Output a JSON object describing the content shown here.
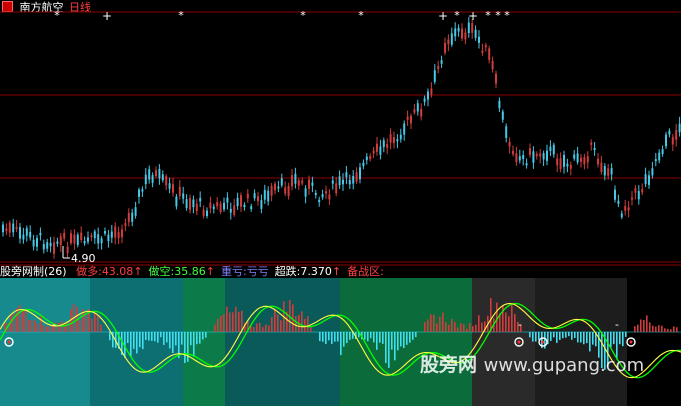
{
  "header": {
    "stock_name": "南方航空",
    "period": "日线"
  },
  "main_chart": {
    "low_marker": "4.90",
    "star_marker": "*",
    "plus_marker": "+"
  },
  "indicator": {
    "name": "股旁网制",
    "params": "(26)",
    "items": [
      {
        "label": "做多:",
        "value": "43.08",
        "arrow": "↑",
        "color": "#ff4040"
      },
      {
        "label": "做空:",
        "value": "35.86",
        "arrow": "↑",
        "color": "#40ff40"
      },
      {
        "label": "重亏:",
        "value": "亏亏",
        "arrow": "",
        "color": "#8080ff"
      },
      {
        "label": "超跌:",
        "value": "7.370",
        "arrow": "↑",
        "color": "#ffffff"
      },
      {
        "label": "备战区:",
        "value": "",
        "arrow": "",
        "color": "#ff4040"
      }
    ],
    "dash_marker": "-"
  },
  "watermark": {
    "cn": "股旁网",
    "domain": "www.gupang.com"
  },
  "colors": {
    "up_candle": "#d23c3c",
    "down_candle": "#46c8e6",
    "grid": "#8b0000",
    "fast_line": "#00ff00",
    "slow_line": "#ffff40"
  }
}
